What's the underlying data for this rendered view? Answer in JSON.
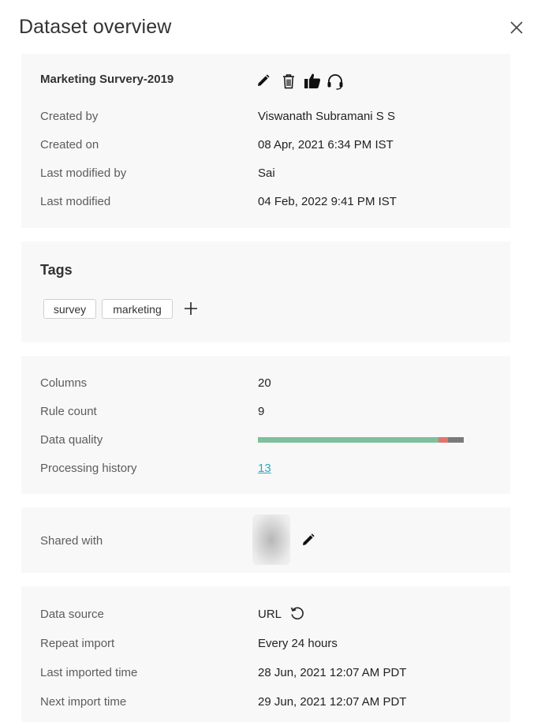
{
  "panel": {
    "title": "Dataset overview"
  },
  "summary": {
    "name": "Marketing Survery-2019",
    "rows": [
      {
        "label": "Created by",
        "value": "Viswanath Subramani S S"
      },
      {
        "label": "Created on",
        "value": "08 Apr, 2021 6:34 PM IST"
      },
      {
        "label": "Last modified by",
        "value": "Sai"
      },
      {
        "label": "Last modified",
        "value": "04 Feb, 2022 9:41 PM IST"
      }
    ],
    "icons": [
      "edit-icon",
      "delete-icon",
      "thumbs-up-icon",
      "support-icon"
    ]
  },
  "tags": {
    "title": "Tags",
    "items": [
      "survey",
      "marketing"
    ],
    "add_icon": "plus-icon"
  },
  "stats": {
    "columns": {
      "label": "Columns",
      "value": "20"
    },
    "rule_count": {
      "label": "Rule count",
      "value": "9"
    },
    "data_quality": {
      "label": "Data quality",
      "segments": [
        {
          "name": "valid",
          "fraction": 0.879,
          "color": "#7fbf9c"
        },
        {
          "name": "invalid",
          "fraction": 0.046,
          "color": "#e0766b"
        },
        {
          "name": "missing",
          "fraction": 0.075,
          "color": "#7a7a7a"
        }
      ]
    },
    "processing_history": {
      "label": "Processing history",
      "value": "13"
    }
  },
  "sharing": {
    "label": "Shared with",
    "edit_icon": "edit-icon"
  },
  "import": {
    "rows": [
      {
        "label": "Data source",
        "value": "URL"
      },
      {
        "label": "Repeat import",
        "value": "Every 24 hours"
      },
      {
        "label": "Last imported time",
        "value": "28 Jun, 2021 12:07 AM PDT"
      },
      {
        "label": "Next import time",
        "value": "29 Jun, 2021 12:07 AM PDT"
      }
    ],
    "refresh_icon": "refresh-icon"
  },
  "colors": {
    "card_bg": "#f8f8f8",
    "link": "#2aa8c8"
  }
}
